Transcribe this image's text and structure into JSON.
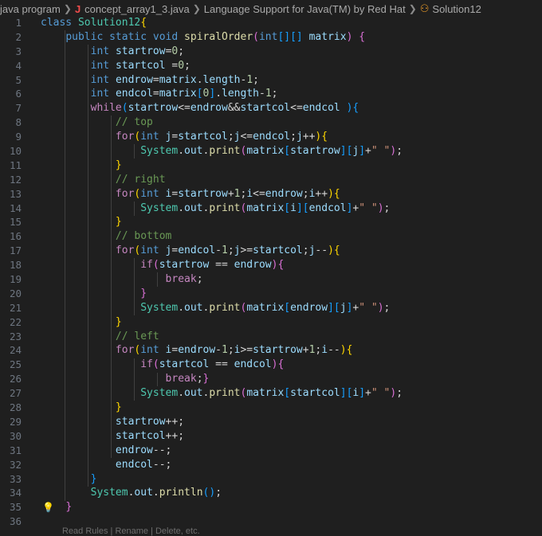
{
  "breadcrumb": {
    "folder": "java program",
    "file": "concept_array1_3.java",
    "provider": "Language Support for Java(TM) by Red Hat",
    "symbol": "Solution12"
  },
  "editor": {
    "lines": [
      [
        [
          "kw",
          "class "
        ],
        [
          "ty",
          "Solution12"
        ],
        [
          "b1",
          "{"
        ]
      ],
      [
        [
          "pl",
          "    "
        ],
        [
          "kw",
          "public "
        ],
        [
          "kw",
          "static "
        ],
        [
          "kw",
          "void "
        ],
        [
          "fn",
          "spiralOrder"
        ],
        [
          "b2",
          "("
        ],
        [
          "kw",
          "int"
        ],
        [
          "b3",
          "[]"
        ],
        [
          "b3",
          "[]"
        ],
        [
          "pl",
          " "
        ],
        [
          "vr",
          "matrix"
        ],
        [
          "b2",
          ")"
        ],
        [
          "pl",
          " "
        ],
        [
          "b2",
          "{"
        ]
      ],
      [
        [
          "pl",
          "        "
        ],
        [
          "kw",
          "int "
        ],
        [
          "vr",
          "startrow"
        ],
        [
          "op",
          "="
        ],
        [
          "nm",
          "0"
        ],
        [
          "pl",
          ";"
        ]
      ],
      [
        [
          "pl",
          "        "
        ],
        [
          "kw",
          "int "
        ],
        [
          "vr",
          "startcol "
        ],
        [
          "op",
          "="
        ],
        [
          "nm",
          "0"
        ],
        [
          "pl",
          ";"
        ]
      ],
      [
        [
          "pl",
          "        "
        ],
        [
          "kw",
          "int "
        ],
        [
          "vr",
          "endrow"
        ],
        [
          "op",
          "="
        ],
        [
          "vr",
          "matrix"
        ],
        [
          "pl",
          "."
        ],
        [
          "vr",
          "length"
        ],
        [
          "op",
          "-"
        ],
        [
          "nm",
          "1"
        ],
        [
          "pl",
          ";"
        ]
      ],
      [
        [
          "pl",
          "        "
        ],
        [
          "kw",
          "int "
        ],
        [
          "vr",
          "endcol"
        ],
        [
          "op",
          "="
        ],
        [
          "vr",
          "matrix"
        ],
        [
          "b3",
          "["
        ],
        [
          "nm",
          "0"
        ],
        [
          "b3",
          "]"
        ],
        [
          "pl",
          "."
        ],
        [
          "vr",
          "length"
        ],
        [
          "op",
          "-"
        ],
        [
          "nm",
          "1"
        ],
        [
          "pl",
          ";"
        ]
      ],
      [
        [
          "pl",
          "        "
        ],
        [
          "ctl",
          "while"
        ],
        [
          "b3",
          "("
        ],
        [
          "vr",
          "startrow"
        ],
        [
          "op",
          "<="
        ],
        [
          "vr",
          "endrow"
        ],
        [
          "op",
          "&&"
        ],
        [
          "vr",
          "startcol"
        ],
        [
          "op",
          "<="
        ],
        [
          "vr",
          "endcol "
        ],
        [
          "b3",
          ")"
        ],
        [
          "b3",
          "{"
        ]
      ],
      [
        [
          "pl",
          "            "
        ],
        [
          "cm",
          "// top"
        ]
      ],
      [
        [
          "pl",
          "            "
        ],
        [
          "ctl",
          "for"
        ],
        [
          "b1",
          "("
        ],
        [
          "kw",
          "int "
        ],
        [
          "vr",
          "j"
        ],
        [
          "op",
          "="
        ],
        [
          "vr",
          "startcol"
        ],
        [
          "pl",
          ";"
        ],
        [
          "vr",
          "j"
        ],
        [
          "op",
          "<="
        ],
        [
          "vr",
          "endcol"
        ],
        [
          "pl",
          ";"
        ],
        [
          "vr",
          "j"
        ],
        [
          "op",
          "++"
        ],
        [
          "b1",
          ")"
        ],
        [
          "b1",
          "{"
        ]
      ],
      [
        [
          "pl",
          "                "
        ],
        [
          "ty",
          "System"
        ],
        [
          "pl",
          "."
        ],
        [
          "vr",
          "out"
        ],
        [
          "pl",
          "."
        ],
        [
          "fn",
          "print"
        ],
        [
          "b2",
          "("
        ],
        [
          "vr",
          "matrix"
        ],
        [
          "b3",
          "["
        ],
        [
          "vr",
          "startrow"
        ],
        [
          "b3",
          "]"
        ],
        [
          "b3",
          "["
        ],
        [
          "vr",
          "j"
        ],
        [
          "b3",
          "]"
        ],
        [
          "op",
          "+"
        ],
        [
          "st",
          "\" \""
        ],
        [
          "b2",
          ")"
        ],
        [
          "pl",
          ";"
        ]
      ],
      [
        [
          "pl",
          "            "
        ],
        [
          "b1",
          "}"
        ]
      ],
      [
        [
          "pl",
          "            "
        ],
        [
          "cm",
          "// right"
        ]
      ],
      [
        [
          "pl",
          "            "
        ],
        [
          "ctl",
          "for"
        ],
        [
          "b1",
          "("
        ],
        [
          "kw",
          "int "
        ],
        [
          "vr",
          "i"
        ],
        [
          "op",
          "="
        ],
        [
          "vr",
          "startrow"
        ],
        [
          "op",
          "+"
        ],
        [
          "nm",
          "1"
        ],
        [
          "pl",
          ";"
        ],
        [
          "vr",
          "i"
        ],
        [
          "op",
          "<="
        ],
        [
          "vr",
          "endrow"
        ],
        [
          "pl",
          ";"
        ],
        [
          "vr",
          "i"
        ],
        [
          "op",
          "++"
        ],
        [
          "b1",
          ")"
        ],
        [
          "b1",
          "{"
        ]
      ],
      [
        [
          "pl",
          "                "
        ],
        [
          "ty",
          "System"
        ],
        [
          "pl",
          "."
        ],
        [
          "vr",
          "out"
        ],
        [
          "pl",
          "."
        ],
        [
          "fn",
          "print"
        ],
        [
          "b2",
          "("
        ],
        [
          "vr",
          "matrix"
        ],
        [
          "b3",
          "["
        ],
        [
          "vr",
          "i"
        ],
        [
          "b3",
          "]"
        ],
        [
          "b3",
          "["
        ],
        [
          "vr",
          "endcol"
        ],
        [
          "b3",
          "]"
        ],
        [
          "op",
          "+"
        ],
        [
          "st",
          "\" \""
        ],
        [
          "b2",
          ")"
        ],
        [
          "pl",
          ";"
        ]
      ],
      [
        [
          "pl",
          "            "
        ],
        [
          "b1",
          "}"
        ]
      ],
      [
        [
          "pl",
          "            "
        ],
        [
          "cm",
          "// bottom"
        ]
      ],
      [
        [
          "pl",
          "            "
        ],
        [
          "ctl",
          "for"
        ],
        [
          "b1",
          "("
        ],
        [
          "kw",
          "int "
        ],
        [
          "vr",
          "j"
        ],
        [
          "op",
          "="
        ],
        [
          "vr",
          "endcol"
        ],
        [
          "op",
          "-"
        ],
        [
          "nm",
          "1"
        ],
        [
          "pl",
          ";"
        ],
        [
          "vr",
          "j"
        ],
        [
          "op",
          ">="
        ],
        [
          "vr",
          "startcol"
        ],
        [
          "pl",
          ";"
        ],
        [
          "vr",
          "j"
        ],
        [
          "op",
          "--"
        ],
        [
          "b1",
          ")"
        ],
        [
          "b1",
          "{"
        ]
      ],
      [
        [
          "pl",
          "                "
        ],
        [
          "ctl",
          "if"
        ],
        [
          "b2",
          "("
        ],
        [
          "vr",
          "startrow"
        ],
        [
          "op",
          " == "
        ],
        [
          "vr",
          "endrow"
        ],
        [
          "b2",
          ")"
        ],
        [
          "b2",
          "{"
        ]
      ],
      [
        [
          "pl",
          "                    "
        ],
        [
          "ctl",
          "break"
        ],
        [
          "pl",
          ";"
        ]
      ],
      [
        [
          "pl",
          "                "
        ],
        [
          "b2",
          "}"
        ]
      ],
      [
        [
          "pl",
          "                "
        ],
        [
          "ty",
          "System"
        ],
        [
          "pl",
          "."
        ],
        [
          "vr",
          "out"
        ],
        [
          "pl",
          "."
        ],
        [
          "fn",
          "print"
        ],
        [
          "b2",
          "("
        ],
        [
          "vr",
          "matrix"
        ],
        [
          "b3",
          "["
        ],
        [
          "vr",
          "endrow"
        ],
        [
          "b3",
          "]"
        ],
        [
          "b3",
          "["
        ],
        [
          "vr",
          "j"
        ],
        [
          "b3",
          "]"
        ],
        [
          "op",
          "+"
        ],
        [
          "st",
          "\" \""
        ],
        [
          "b2",
          ")"
        ],
        [
          "pl",
          ";"
        ]
      ],
      [
        [
          "pl",
          "            "
        ],
        [
          "b1",
          "}"
        ]
      ],
      [
        [
          "pl",
          "            "
        ],
        [
          "cm",
          "// left"
        ]
      ],
      [
        [
          "pl",
          "            "
        ],
        [
          "ctl",
          "for"
        ],
        [
          "b1",
          "("
        ],
        [
          "kw",
          "int "
        ],
        [
          "vr",
          "i"
        ],
        [
          "op",
          "="
        ],
        [
          "vr",
          "endrow"
        ],
        [
          "op",
          "-"
        ],
        [
          "nm",
          "1"
        ],
        [
          "pl",
          ";"
        ],
        [
          "vr",
          "i"
        ],
        [
          "op",
          ">="
        ],
        [
          "vr",
          "startrow"
        ],
        [
          "op",
          "+"
        ],
        [
          "nm",
          "1"
        ],
        [
          "pl",
          ";"
        ],
        [
          "vr",
          "i"
        ],
        [
          "op",
          "--"
        ],
        [
          "b1",
          ")"
        ],
        [
          "b1",
          "{"
        ]
      ],
      [
        [
          "pl",
          "                "
        ],
        [
          "ctl",
          "if"
        ],
        [
          "b2",
          "("
        ],
        [
          "vr",
          "startcol"
        ],
        [
          "op",
          " == "
        ],
        [
          "vr",
          "endcol"
        ],
        [
          "b2",
          ")"
        ],
        [
          "b2",
          "{"
        ]
      ],
      [
        [
          "pl",
          "                    "
        ],
        [
          "ctl",
          "break"
        ],
        [
          "pl",
          ";"
        ],
        [
          "b2",
          "}"
        ]
      ],
      [
        [
          "pl",
          "                "
        ],
        [
          "ty",
          "System"
        ],
        [
          "pl",
          "."
        ],
        [
          "vr",
          "out"
        ],
        [
          "pl",
          "."
        ],
        [
          "fn",
          "print"
        ],
        [
          "b2",
          "("
        ],
        [
          "vr",
          "matrix"
        ],
        [
          "b3",
          "["
        ],
        [
          "vr",
          "startcol"
        ],
        [
          "b3",
          "]"
        ],
        [
          "b3",
          "["
        ],
        [
          "vr",
          "i"
        ],
        [
          "b3",
          "]"
        ],
        [
          "op",
          "+"
        ],
        [
          "st",
          "\" \""
        ],
        [
          "b2",
          ")"
        ],
        [
          "pl",
          ";"
        ]
      ],
      [
        [
          "pl",
          "            "
        ],
        [
          "b1",
          "}"
        ]
      ],
      [
        [
          "pl",
          "            "
        ],
        [
          "vr",
          "startrow"
        ],
        [
          "op",
          "++"
        ],
        [
          "pl",
          ";"
        ]
      ],
      [
        [
          "pl",
          "            "
        ],
        [
          "vr",
          "startcol"
        ],
        [
          "op",
          "++"
        ],
        [
          "pl",
          ";"
        ]
      ],
      [
        [
          "pl",
          "            "
        ],
        [
          "vr",
          "endrow"
        ],
        [
          "op",
          "--"
        ],
        [
          "pl",
          ";"
        ]
      ],
      [
        [
          "pl",
          "            "
        ],
        [
          "vr",
          "endcol"
        ],
        [
          "op",
          "--"
        ],
        [
          "pl",
          ";"
        ]
      ],
      [
        [
          "pl",
          "        "
        ],
        [
          "b3",
          "}"
        ]
      ],
      [
        [
          "pl",
          "        "
        ],
        [
          "ty",
          "System"
        ],
        [
          "pl",
          "."
        ],
        [
          "vr",
          "out"
        ],
        [
          "pl",
          "."
        ],
        [
          "fn",
          "println"
        ],
        [
          "b3",
          "()"
        ],
        [
          "pl",
          ";"
        ]
      ],
      [
        [
          "pl",
          "    "
        ],
        [
          "b2",
          "}"
        ]
      ],
      []
    ],
    "lightbulb_line": 35
  },
  "bottom_text": "Read Rules | Rename | Delete, etc."
}
